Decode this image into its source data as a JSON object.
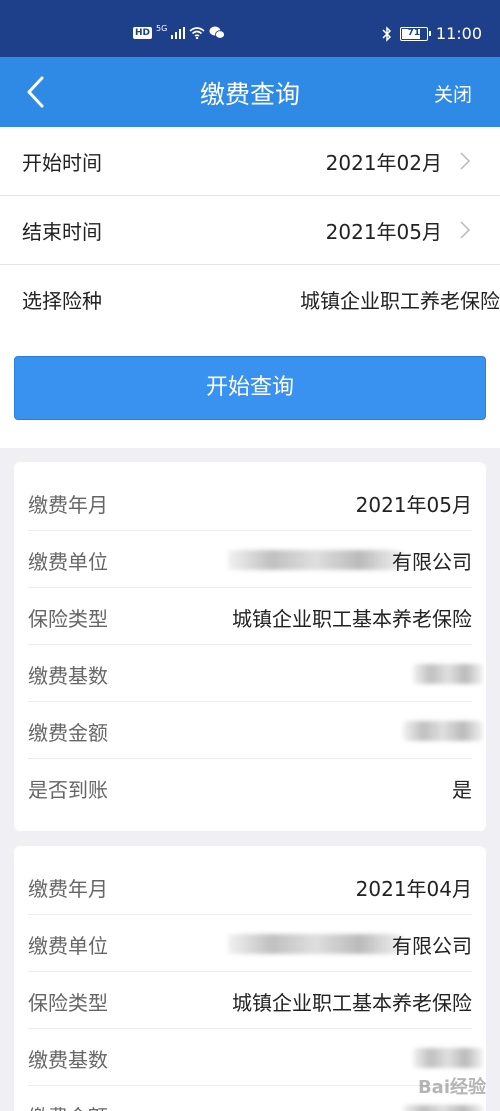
{
  "status_bar": {
    "hd": "HD",
    "network": "5G",
    "battery": "71",
    "time": "11:00"
  },
  "nav": {
    "title": "缴费查询",
    "close_label": "关闭"
  },
  "form": {
    "start": {
      "label": "开始时间",
      "value": "2021年02月"
    },
    "end": {
      "label": "结束时间",
      "value": "2021年05月"
    },
    "insurance": {
      "label": "选择险种",
      "value": "城镇企业职工养老保险"
    },
    "query_button": "开始查询"
  },
  "records": [
    {
      "month_label": "缴费年月",
      "month": "2021年05月",
      "unit_label": "缴费单位",
      "unit": "有限公司",
      "type_label": "保险类型",
      "type": "城镇企业职工基本养老保险",
      "base_label": "缴费基数",
      "amount_label": "缴费金额",
      "arrived_label": "是否到账",
      "arrived": "是"
    },
    {
      "month_label": "缴费年月",
      "month": "2021年04月",
      "unit_label": "缴费单位",
      "unit": "有限公司",
      "type_label": "保险类型",
      "type": "城镇企业职工基本养老保险",
      "base_label": "缴费基数",
      "amount_label": "缴费金额"
    }
  ],
  "watermark": "Bai经验",
  "colors": {
    "status_bar": "#1e3f8a",
    "nav_bar": "#2f8ae6",
    "button": "#3a92f0",
    "background": "#efeff4"
  }
}
